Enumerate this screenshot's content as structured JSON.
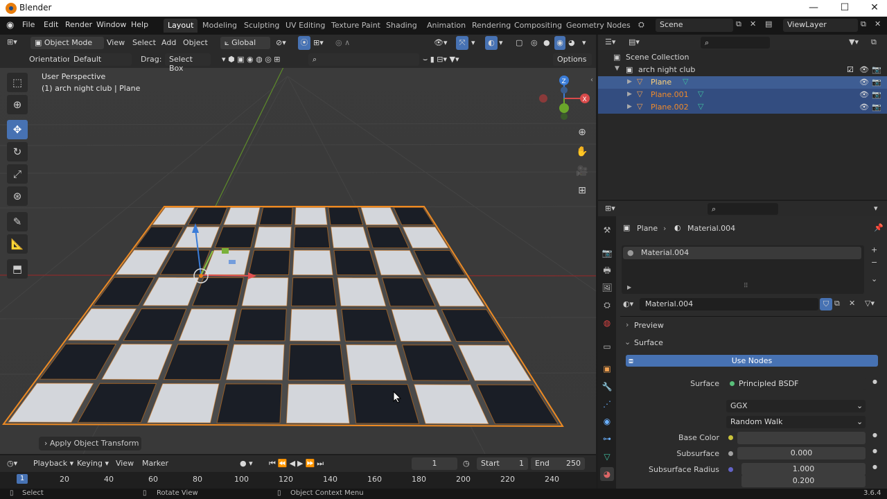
{
  "window": {
    "title": "Blender",
    "min": "—",
    "max": "☐",
    "close": "✕"
  },
  "menu": [
    "File",
    "Edit",
    "Render",
    "Window",
    "Help"
  ],
  "workspaces": [
    "Layout",
    "Modeling",
    "Sculpting",
    "UV Editing",
    "Texture Paint",
    "Shading",
    "Animation",
    "Rendering",
    "Compositing",
    "Geometry Nodes"
  ],
  "scene": {
    "name": "Scene",
    "view_layer": "ViewLayer"
  },
  "viewport_header": {
    "mode": "Object Mode",
    "menus": [
      "View",
      "Select",
      "Add",
      "Object"
    ],
    "transform": "Global"
  },
  "tool_settings": {
    "orientation_label": "Orientation:",
    "orientation_value": "Default",
    "drag_label": "Drag:",
    "drag_value": "Select Box",
    "options": "Options"
  },
  "overlay_text": {
    "perspective": "User Perspective",
    "context": "(1) arch night club | Plane"
  },
  "last_op": "Apply Object Transform",
  "timeline": {
    "menus": [
      "Playback",
      "Keying",
      "View",
      "Marker"
    ],
    "current_frame": "1",
    "start_label": "Start",
    "start": "1",
    "end_label": "End",
    "end": "250",
    "ruler": [
      "1",
      "20",
      "40",
      "60",
      "80",
      "100",
      "120",
      "140",
      "160",
      "180",
      "200",
      "220",
      "240"
    ]
  },
  "status": {
    "select": "Select",
    "rotate": "Rotate View",
    "context_menu": "Object Context Menu",
    "version": "3.6.4"
  },
  "outliner": {
    "root": "Scene Collection",
    "collection": "arch night club",
    "objects": [
      {
        "name": "Plane",
        "selected": true,
        "active": true
      },
      {
        "name": "Plane.001",
        "selected": true,
        "active": false
      },
      {
        "name": "Plane.002",
        "selected": true,
        "active": false
      }
    ]
  },
  "properties": {
    "breadcrumb_object": "Plane",
    "breadcrumb_material": "Material.004",
    "slot": "Material.004",
    "material_name": "Material.004",
    "panel_preview": "Preview",
    "panel_surface": "Surface",
    "use_nodes": "Use Nodes",
    "surface_label": "Surface",
    "surface_value": "Principled BSDF",
    "distribution": "GGX",
    "subsurface_method": "Random Walk",
    "base_color_label": "Base Color",
    "subsurface_label": "Subsurface",
    "subsurface_value": "0.000",
    "subsurface_radius_label": "Subsurface Radius",
    "radius_1": "1.000",
    "radius_2": "0.200"
  },
  "colors": {
    "accent": "#4772b3",
    "selection": "#334d80",
    "object_orange": "#e8801a",
    "grid_dark": "#1a1e26",
    "grid_light": "#d3d6db"
  }
}
